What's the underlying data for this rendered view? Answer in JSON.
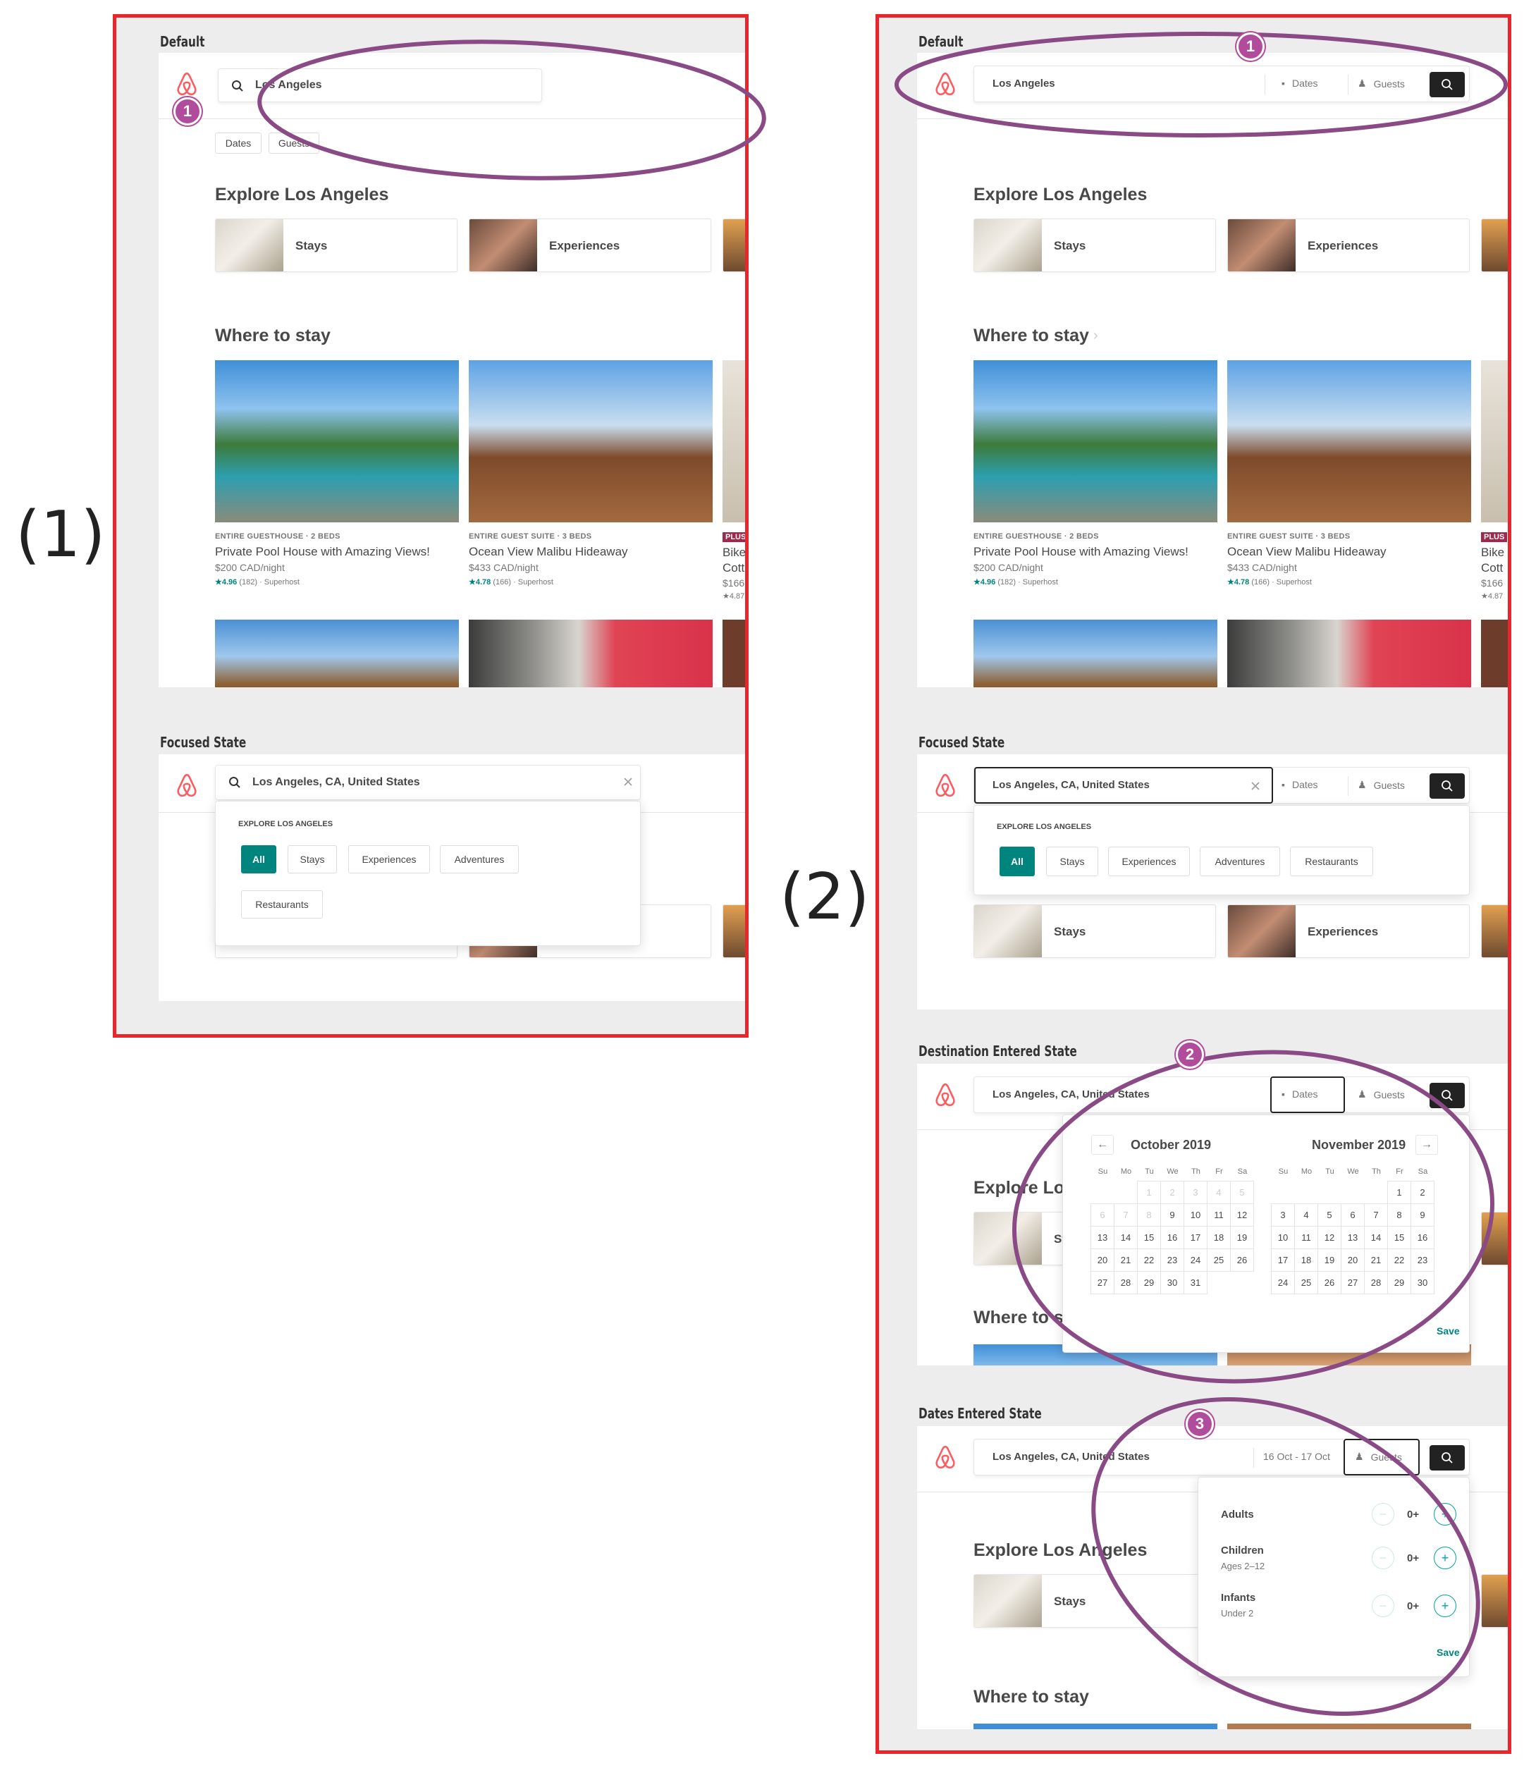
{
  "figure_labels": {
    "left": "(1)",
    "right": "(2)"
  },
  "sections": {
    "default": "Default",
    "focused": "Focused State",
    "destination": "Destination Entered State",
    "dates": "Dates Entered State"
  },
  "search": {
    "query_default": "Los Angeles",
    "query_full": "Los Angeles, CA, United States",
    "dates_label": "Dates",
    "guests_label": "Guests",
    "dates_value": "16 Oct - 17 Oct"
  },
  "explore": {
    "title": "Explore Los Angeles",
    "categories": [
      "Stays",
      "Experiences"
    ]
  },
  "where_to_stay": {
    "title": "Where to stay",
    "listings": [
      {
        "kind": "ENTIRE GUESTHOUSE · 2 BEDS",
        "title": "Private Pool House with Amazing Views!",
        "price": "$200 CAD/night",
        "rating": "★4.96",
        "reviews": "(182) · Superhost"
      },
      {
        "kind": "ENTIRE GUEST SUITE · 3 BEDS",
        "title": "Ocean View Malibu Hideaway",
        "price": "$433 CAD/night",
        "rating": "★4.78",
        "reviews": "(166) · Superhost"
      },
      {
        "kind": "PLUS",
        "title": "Bike Cott",
        "price": "$166",
        "rating": "★4.87"
      }
    ]
  },
  "suggest": {
    "heading": "EXPLORE LOS ANGELES",
    "chips": [
      "All",
      "Stays",
      "Experiences",
      "Adventures",
      "Restaurants"
    ]
  },
  "calendar": {
    "months": [
      {
        "name": "October 2019",
        "lead": 2,
        "days": 31,
        "past_until": 8
      },
      {
        "name": "November 2019",
        "lead": 5,
        "days": 30,
        "past_until": 0
      }
    ],
    "dow": [
      "Su",
      "Mo",
      "Tu",
      "We",
      "Th",
      "Fr",
      "Sa"
    ],
    "save": "Save"
  },
  "guests": {
    "rows": [
      {
        "label": "Adults",
        "sub": "",
        "value": "0+"
      },
      {
        "label": "Children",
        "sub": "Ages 2–12",
        "value": "0+"
      },
      {
        "label": "Infants",
        "sub": "Under 2",
        "value": "0+"
      }
    ],
    "save": "Save"
  },
  "badges": [
    "1",
    "1",
    "2",
    "3"
  ],
  "colors": {
    "frame": "#e8262b",
    "accent": "#00857e",
    "annotation": "#8a4a85",
    "brand": "#ff5a5f"
  }
}
